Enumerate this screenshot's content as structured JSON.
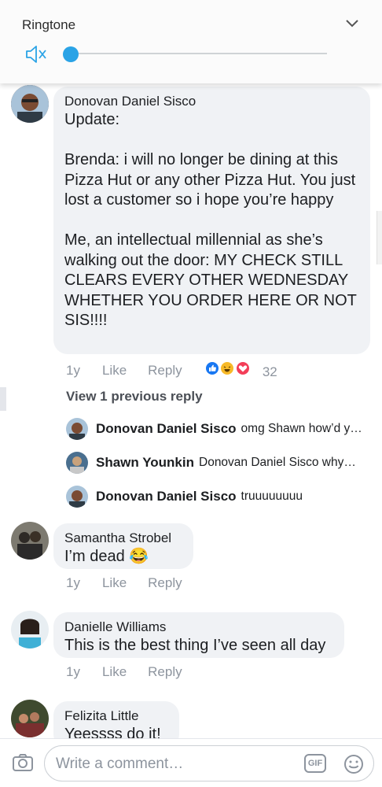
{
  "ringtone": {
    "title": "Ringtone",
    "volume_level": 0.0,
    "muted": true
  },
  "comments": [
    {
      "author": "Donovan Daniel Sisco",
      "text": "Update:\n\nBrenda: i will no longer be dining at this Pizza Hut or any other Pizza Hut. You just lost a customer so i hope you’re happy\n\nMe, an intellectual millennial as she’s walking out the door: MY CHECK STILL CLEARS EVERY OTHER WEDNESDAY WHETHER YOU ORDER HERE OR NOT SIS!!!!",
      "age": "1y",
      "like": "Like",
      "reply": "Reply",
      "reaction_count": "32",
      "reactions": [
        "like",
        "haha",
        "love"
      ]
    },
    {
      "author": "Samantha Strobel",
      "text": "I’m dead 😂",
      "age": "1y",
      "like": "Like",
      "reply": "Reply"
    },
    {
      "author": "Danielle Williams",
      "text": "This is the best thing I’ve seen all day",
      "age": "1y",
      "like": "Like",
      "reply": "Reply"
    },
    {
      "author": "Felizita Little",
      "text": "Yeessss do it!"
    }
  ],
  "view_previous": "View 1 previous reply",
  "replies": [
    {
      "author": "Donovan Daniel Sisco",
      "snippet": "omg Shawn how’d y…"
    },
    {
      "author": "Shawn Younkin",
      "snippet": "Donovan Daniel Sisco why…"
    },
    {
      "author": "Donovan Daniel Sisco",
      "snippet": "truuuuuuuu"
    }
  ],
  "composer": {
    "placeholder": "Write a comment…",
    "gif_label": "GIF"
  },
  "colors": {
    "accent": "#2aa3e6",
    "bubble": "#f0f2f5",
    "like_blue": "#1877f2",
    "haha_yellow": "#f7b928",
    "love_red": "#f33e58",
    "secondary_text": "#8d949e"
  },
  "icons": [
    "chevron-down-icon",
    "mute-icon",
    "camera-icon",
    "gif-icon",
    "emoji-icon",
    "like-reaction-icon",
    "haha-reaction-icon",
    "love-reaction-icon"
  ]
}
